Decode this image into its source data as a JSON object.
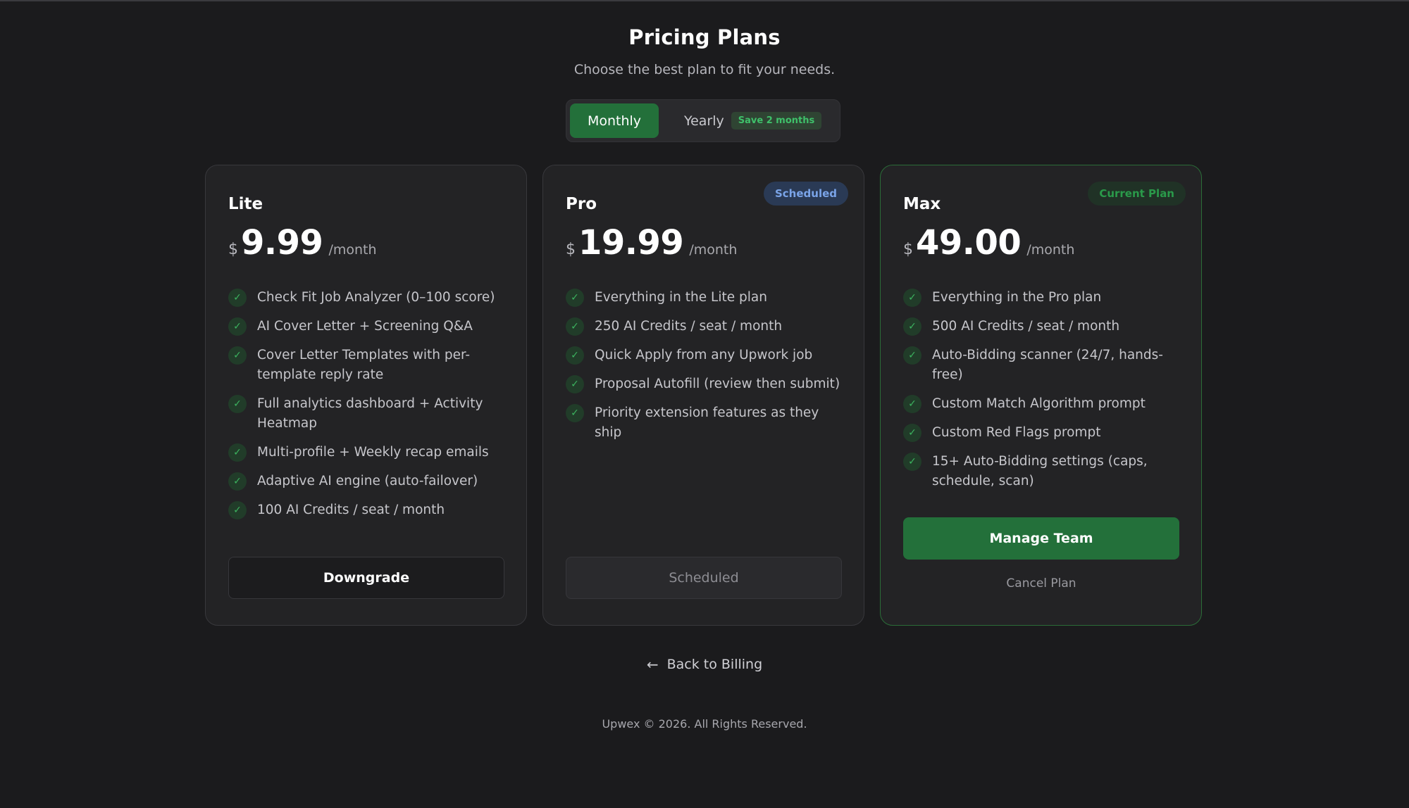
{
  "header": {
    "title": "Pricing Plans",
    "subtitle": "Choose the best plan to fit your needs."
  },
  "billing_toggle": {
    "monthly_label": "Monthly",
    "yearly_label": "Yearly",
    "yearly_badge": "Save 2 months",
    "selected": "Monthly"
  },
  "plans": [
    {
      "name": "Lite",
      "currency": "$",
      "price": "9.99",
      "period": "/month",
      "features": [
        "Check Fit Job Analyzer (0–100 score)",
        "AI Cover Letter + Screening Q&A",
        "Cover Letter Templates with per-template reply rate",
        "Full analytics dashboard + Activity Heatmap",
        "Multi-profile + Weekly recap emails",
        "Adaptive AI engine (auto-failover)",
        "100 AI Credits / seat / month"
      ],
      "button_label": "Downgrade"
    },
    {
      "name": "Pro",
      "badge": "Scheduled",
      "currency": "$",
      "price": "19.99",
      "period": "/month",
      "features": [
        "Everything in the Lite plan",
        "250 AI Credits / seat / month",
        "Quick Apply from any Upwork job",
        "Proposal Autofill (review then submit)",
        "Priority extension features as they ship"
      ],
      "button_label": "Scheduled"
    },
    {
      "name": "Max",
      "badge": "Current Plan",
      "currency": "$",
      "price": "49.00",
      "period": "/month",
      "features": [
        "Everything in the Pro plan",
        "500 AI Credits / seat / month",
        "Auto-Bidding scanner (24/7, hands-free)",
        "Custom Match Algorithm prompt",
        "Custom Red Flags prompt",
        "15+ Auto-Bidding settings (caps, schedule, scan)"
      ],
      "button_label": "Manage Team",
      "secondary_link": "Cancel Plan"
    }
  ],
  "back_link": {
    "label": "Back to Billing",
    "icon": "arrow-left-icon"
  },
  "footer": {
    "text": "Upwex © 2026. All Rights Reserved."
  },
  "colors": {
    "background": "#1b1b1d",
    "accent_green": "#23703a",
    "scheduled_blue": "#7aa4e8",
    "current_green": "#2a9a4a"
  }
}
